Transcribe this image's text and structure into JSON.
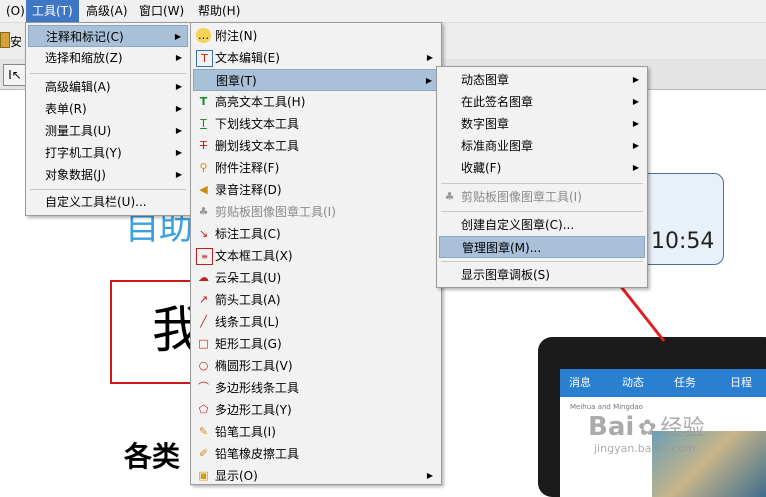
{
  "menubar": {
    "items": [
      {
        "label": "(O)"
      },
      {
        "label": "工具(T)"
      },
      {
        "label": "高级(A)"
      },
      {
        "label": "窗口(W)"
      },
      {
        "label": "帮助(H)"
      }
    ]
  },
  "toolbar": {
    "partial_label": "安"
  },
  "doc": {
    "partial_title": "自助",
    "clock": "10:54",
    "partial_char": "我",
    "heading_partial": "各类"
  },
  "tablet": {
    "tabs": [
      "消息",
      "动态",
      "任务",
      "日程"
    ],
    "sub_text": "Meihua and Mingdao"
  },
  "watermark": {
    "main": "Bai",
    "cn": "经验",
    "url": "jingyan.baidu.com"
  },
  "menu1": {
    "items": [
      {
        "label": "注释和标记(C)",
        "arrow": true
      },
      {
        "label": "选择和缩放(Z)",
        "arrow": true
      },
      {
        "label": "高级编辑(A)",
        "arrow": true
      },
      {
        "label": "表单(R)",
        "arrow": true
      },
      {
        "label": "测量工具(U)",
        "arrow": true
      },
      {
        "label": "打字机工具(Y)",
        "arrow": true
      },
      {
        "label": "对象数据(J)",
        "arrow": true
      },
      {
        "label": "自定义工具栏(U)...",
        "arrow": false
      }
    ]
  },
  "menu2": {
    "items": [
      {
        "label": "附注(N)",
        "icon": "note-icon"
      },
      {
        "label": "文本编辑(E)",
        "icon": "text-edit-icon",
        "arrow": true
      },
      {
        "label": "图章(T)",
        "icon": "stamp-icon",
        "arrow": true
      },
      {
        "label": "高亮文本工具(H)",
        "icon": "highlight-icon"
      },
      {
        "label": "下划线文本工具",
        "icon": "underline-icon"
      },
      {
        "label": "删划线文本工具",
        "icon": "strikeout-icon"
      },
      {
        "label": "附件注释(F)",
        "icon": "attachment-icon"
      },
      {
        "label": "录音注释(D)",
        "icon": "sound-icon"
      },
      {
        "label": "剪贴板图像图章工具(I)",
        "icon": "clipboard-stamp-icon",
        "disabled": true
      },
      {
        "label": "标注工具(C)",
        "icon": "callout-icon"
      },
      {
        "label": "文本框工具(X)",
        "icon": "textbox-icon"
      },
      {
        "label": "云朵工具(U)",
        "icon": "cloud-icon"
      },
      {
        "label": "箭头工具(A)",
        "icon": "arrow-tool-icon"
      },
      {
        "label": "线条工具(L)",
        "icon": "line-tool-icon"
      },
      {
        "label": "矩形工具(G)",
        "icon": "rectangle-icon"
      },
      {
        "label": "椭圆形工具(V)",
        "icon": "ellipse-icon"
      },
      {
        "label": "多边形线条工具",
        "icon": "polyline-icon"
      },
      {
        "label": "多边形工具(Y)",
        "icon": "polygon-icon"
      },
      {
        "label": "铅笔工具(I)",
        "icon": "pencil-icon"
      },
      {
        "label": "铅笔橡皮擦工具",
        "icon": "eraser-icon"
      },
      {
        "label": "显示(O)",
        "icon": "show-icon",
        "arrow": true
      }
    ]
  },
  "menu3": {
    "items": [
      {
        "label": "动态图章",
        "arrow": true
      },
      {
        "label": "在此签名图章",
        "arrow": true
      },
      {
        "label": "数字图章",
        "arrow": true
      },
      {
        "label": "标准商业图章",
        "arrow": true
      },
      {
        "label": "收藏(F)",
        "arrow": true
      },
      {
        "label": "剪贴板图像图章工具(I)",
        "disabled": true,
        "icon": "clipboard-stamp-icon"
      },
      {
        "label": "创建自定义图章(C)..."
      },
      {
        "label": "管理图章(M)..."
      },
      {
        "label": "显示图章调板(S)"
      }
    ]
  },
  "colors": {
    "highlight": "#a8c0d8",
    "menubar_active": "#3e78c5",
    "arrow": "#e02020",
    "title_blue": "#3aa0e0"
  }
}
